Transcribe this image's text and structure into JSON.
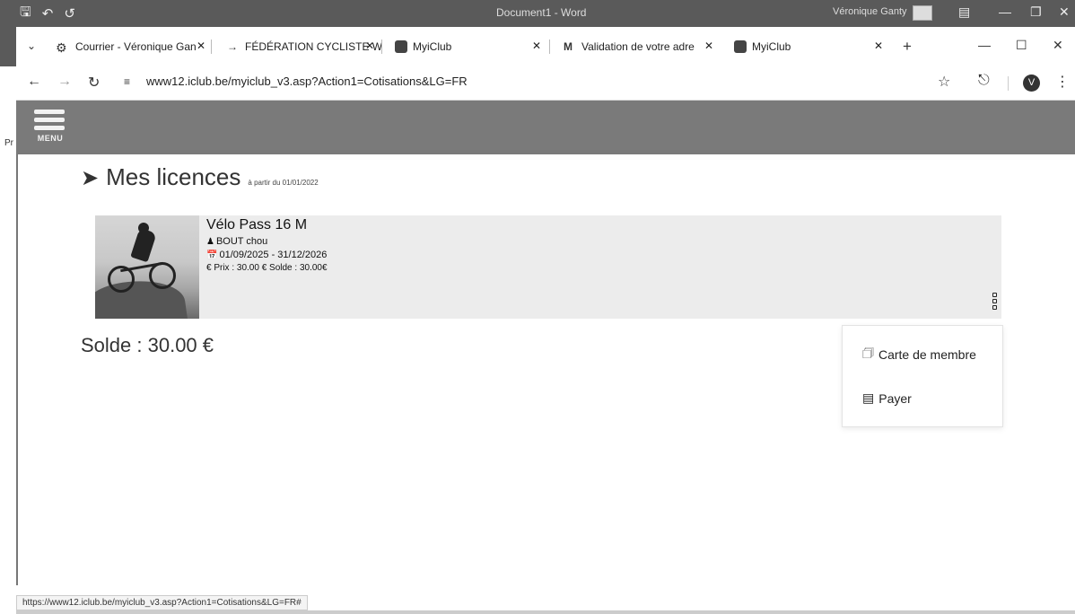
{
  "word": {
    "doc_title": "Document1 - Word",
    "user": "Véronique Ganty"
  },
  "tabs": [
    {
      "label": "Courrier - Véronique Gan",
      "icon": "gear-icon"
    },
    {
      "label": "FÉDÉRATION CYCLISTE W",
      "icon": "arrow-icon"
    },
    {
      "label": "MyiClub",
      "icon": "myiclub-icon"
    },
    {
      "label": "Validation de votre adre",
      "icon": "gmail-icon"
    },
    {
      "label": "MyiClub",
      "icon": "myiclub-icon"
    }
  ],
  "address": {
    "url": "www12.iclub.be/myiclub_v3.asp?Action1=Cotisations&LG=FR",
    "profile_initial": "V"
  },
  "header": {
    "menu_label": "MENU",
    "background": "#7a7a7a"
  },
  "page": {
    "title": "Mes licences",
    "subtitle": "à partir du 01/01/2022"
  },
  "license": {
    "name": "Vélo Pass 16 M",
    "member": "BOUT chou",
    "period": "01/09/2025 - 31/12/2026",
    "price": "€ Prix : 30.00 €   Solde : 30.00€"
  },
  "solde_total": "Solde : 30.00 €",
  "popup": {
    "carte_label": "Carte de membre",
    "payer_label": "Payer"
  },
  "status_url": "https://www12.iclub.be/myiclub_v3.asp?Action1=Cotisations&LG=FR#",
  "background_text": "Pr"
}
